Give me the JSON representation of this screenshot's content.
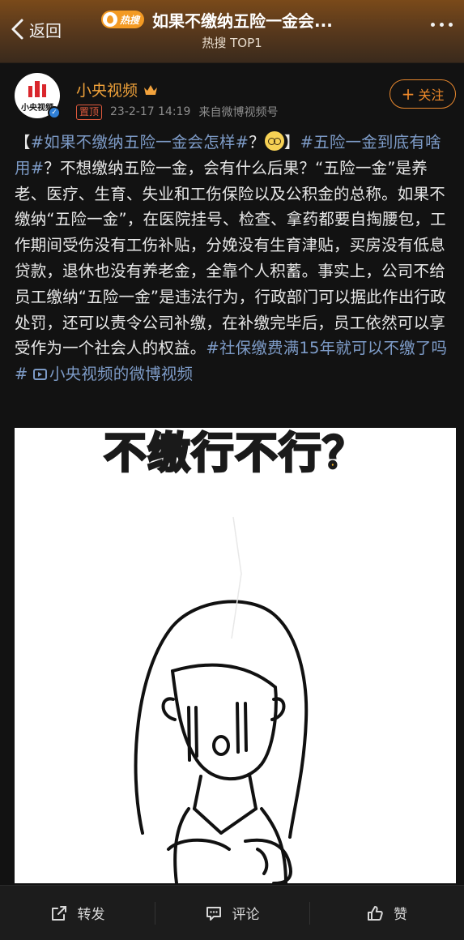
{
  "header": {
    "back_label": "返回",
    "hot_badge": "热搜",
    "title": "如果不缴纳五险一金会...",
    "subtitle": "热搜 TOP1"
  },
  "post": {
    "author": "小央视频",
    "avatar_text": "小央视频",
    "pin_label": "置顶",
    "time": "23-2-17 14:19",
    "source": "来自微博视频号",
    "follow_label": "关注",
    "text": {
      "bracket_open": "【",
      "tag1": "#如果不缴纳五险一金会怎样#",
      "after_tag1": "？",
      "bracket_close": "】",
      "tag2": "#五险一金到底有啥用#",
      "body": "？不想缴纳五险一金，会有什么后果？“五险一金”是养老、医疗、生育、失业和工伤保险以及公积金的总称。如果不缴纳“五险一金”，在医院挂号、检查、拿药都要自掏腰包，工作期间受伤没有工伤补贴，分娩没有生育津贴，买房没有低息贷款，退休也没有养老金，全靠个人积蓄。事实上，公司不给员工缴纳“五险一金”是违法行为，行政部门可以据此作出行政处罚，还可以责令公司补缴，在补缴完毕后，员工依然可以享受作为一个社会人的权益。",
      "tag3": "#社保缴费满15年就可以不缴了吗#",
      "video_link": "小央视频的微博视频"
    },
    "video_caption": "不缴行不行？"
  },
  "actions": {
    "repost": "转发",
    "comment": "评论",
    "like": "赞"
  },
  "colors": {
    "accent": "#f08a2a",
    "tag": "#7d9bc7",
    "caption": "#f7b526"
  }
}
